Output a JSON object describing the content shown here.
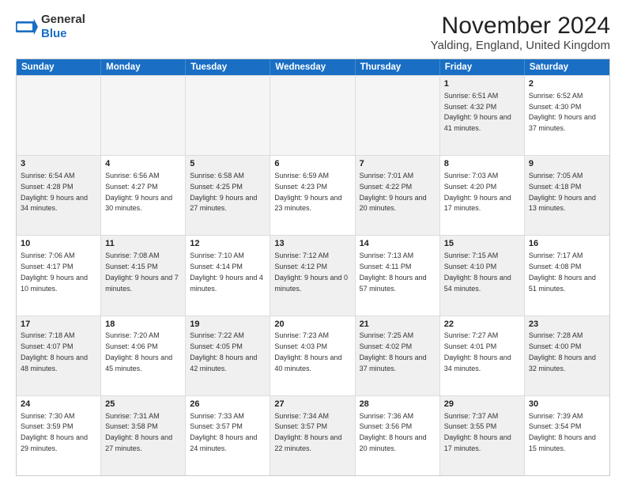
{
  "logo": {
    "general": "General",
    "blue": "Blue"
  },
  "title": "November 2024",
  "subtitle": "Yalding, England, United Kingdom",
  "header_days": [
    "Sunday",
    "Monday",
    "Tuesday",
    "Wednesday",
    "Thursday",
    "Friday",
    "Saturday"
  ],
  "weeks": [
    [
      {
        "day": "",
        "empty": true
      },
      {
        "day": "",
        "empty": true
      },
      {
        "day": "",
        "empty": true
      },
      {
        "day": "",
        "empty": true
      },
      {
        "day": "",
        "empty": true
      },
      {
        "day": "1",
        "text": "Sunrise: 6:51 AM\nSunset: 4:32 PM\nDaylight: 9 hours and 41 minutes.",
        "shaded": true
      },
      {
        "day": "2",
        "text": "Sunrise: 6:52 AM\nSunset: 4:30 PM\nDaylight: 9 hours and 37 minutes.",
        "shaded": false
      }
    ],
    [
      {
        "day": "3",
        "text": "Sunrise: 6:54 AM\nSunset: 4:28 PM\nDaylight: 9 hours and 34 minutes.",
        "shaded": true
      },
      {
        "day": "4",
        "text": "Sunrise: 6:56 AM\nSunset: 4:27 PM\nDaylight: 9 hours and 30 minutes.",
        "shaded": false
      },
      {
        "day": "5",
        "text": "Sunrise: 6:58 AM\nSunset: 4:25 PM\nDaylight: 9 hours and 27 minutes.",
        "shaded": true
      },
      {
        "day": "6",
        "text": "Sunrise: 6:59 AM\nSunset: 4:23 PM\nDaylight: 9 hours and 23 minutes.",
        "shaded": false
      },
      {
        "day": "7",
        "text": "Sunrise: 7:01 AM\nSunset: 4:22 PM\nDaylight: 9 hours and 20 minutes.",
        "shaded": true
      },
      {
        "day": "8",
        "text": "Sunrise: 7:03 AM\nSunset: 4:20 PM\nDaylight: 9 hours and 17 minutes.",
        "shaded": false
      },
      {
        "day": "9",
        "text": "Sunrise: 7:05 AM\nSunset: 4:18 PM\nDaylight: 9 hours and 13 minutes.",
        "shaded": true
      }
    ],
    [
      {
        "day": "10",
        "text": "Sunrise: 7:06 AM\nSunset: 4:17 PM\nDaylight: 9 hours and 10 minutes.",
        "shaded": false
      },
      {
        "day": "11",
        "text": "Sunrise: 7:08 AM\nSunset: 4:15 PM\nDaylight: 9 hours and 7 minutes.",
        "shaded": true
      },
      {
        "day": "12",
        "text": "Sunrise: 7:10 AM\nSunset: 4:14 PM\nDaylight: 9 hours and 4 minutes.",
        "shaded": false
      },
      {
        "day": "13",
        "text": "Sunrise: 7:12 AM\nSunset: 4:12 PM\nDaylight: 9 hours and 0 minutes.",
        "shaded": true
      },
      {
        "day": "14",
        "text": "Sunrise: 7:13 AM\nSunset: 4:11 PM\nDaylight: 8 hours and 57 minutes.",
        "shaded": false
      },
      {
        "day": "15",
        "text": "Sunrise: 7:15 AM\nSunset: 4:10 PM\nDaylight: 8 hours and 54 minutes.",
        "shaded": true
      },
      {
        "day": "16",
        "text": "Sunrise: 7:17 AM\nSunset: 4:08 PM\nDaylight: 8 hours and 51 minutes.",
        "shaded": false
      }
    ],
    [
      {
        "day": "17",
        "text": "Sunrise: 7:18 AM\nSunset: 4:07 PM\nDaylight: 8 hours and 48 minutes.",
        "shaded": true
      },
      {
        "day": "18",
        "text": "Sunrise: 7:20 AM\nSunset: 4:06 PM\nDaylight: 8 hours and 45 minutes.",
        "shaded": false
      },
      {
        "day": "19",
        "text": "Sunrise: 7:22 AM\nSunset: 4:05 PM\nDaylight: 8 hours and 42 minutes.",
        "shaded": true
      },
      {
        "day": "20",
        "text": "Sunrise: 7:23 AM\nSunset: 4:03 PM\nDaylight: 8 hours and 40 minutes.",
        "shaded": false
      },
      {
        "day": "21",
        "text": "Sunrise: 7:25 AM\nSunset: 4:02 PM\nDaylight: 8 hours and 37 minutes.",
        "shaded": true
      },
      {
        "day": "22",
        "text": "Sunrise: 7:27 AM\nSunset: 4:01 PM\nDaylight: 8 hours and 34 minutes.",
        "shaded": false
      },
      {
        "day": "23",
        "text": "Sunrise: 7:28 AM\nSunset: 4:00 PM\nDaylight: 8 hours and 32 minutes.",
        "shaded": true
      }
    ],
    [
      {
        "day": "24",
        "text": "Sunrise: 7:30 AM\nSunset: 3:59 PM\nDaylight: 8 hours and 29 minutes.",
        "shaded": false
      },
      {
        "day": "25",
        "text": "Sunrise: 7:31 AM\nSunset: 3:58 PM\nDaylight: 8 hours and 27 minutes.",
        "shaded": true
      },
      {
        "day": "26",
        "text": "Sunrise: 7:33 AM\nSunset: 3:57 PM\nDaylight: 8 hours and 24 minutes.",
        "shaded": false
      },
      {
        "day": "27",
        "text": "Sunrise: 7:34 AM\nSunset: 3:57 PM\nDaylight: 8 hours and 22 minutes.",
        "shaded": true
      },
      {
        "day": "28",
        "text": "Sunrise: 7:36 AM\nSunset: 3:56 PM\nDaylight: 8 hours and 20 minutes.",
        "shaded": false
      },
      {
        "day": "29",
        "text": "Sunrise: 7:37 AM\nSunset: 3:55 PM\nDaylight: 8 hours and 17 minutes.",
        "shaded": true
      },
      {
        "day": "30",
        "text": "Sunrise: 7:39 AM\nSunset: 3:54 PM\nDaylight: 8 hours and 15 minutes.",
        "shaded": false
      }
    ]
  ]
}
